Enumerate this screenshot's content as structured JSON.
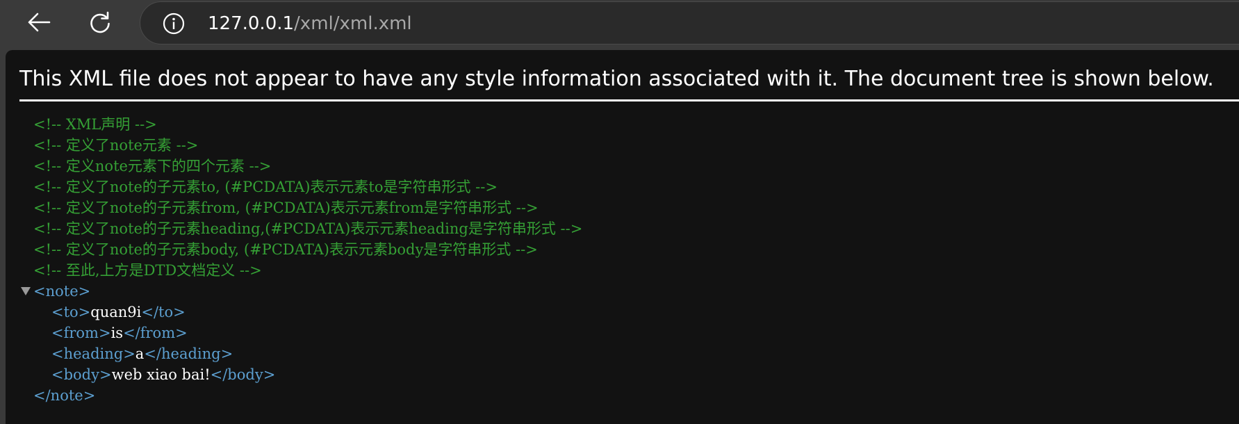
{
  "browser": {
    "url_host": "127.0.0.1",
    "url_path": "/xml/xml.xml",
    "back_icon": "arrow-left-icon",
    "reload_icon": "reload-icon",
    "info_icon": "info-icon"
  },
  "page": {
    "notice": "This XML file does not appear to have any style information associated with it. The document tree is shown below."
  },
  "comments": [
    "<!-- XML声明  -->",
    "<!-- 定义了note元素 -->",
    "<!-- 定义note元素下的四个元素 -->",
    "<!-- 定义了note的子元素to, (#PCDATA)表示元素to是字符串形式 -->",
    "<!-- 定义了note的子元素from, (#PCDATA)表示元素from是字符串形式 -->",
    "<!-- 定义了note的子元素heading,(#PCDATA)表示元素heading是字符串形式 -->",
    "<!-- 定义了note的子元素body, (#PCDATA)表示元素body是字符串形式 -->",
    "<!--  至此,上方是DTD文档定义 -->"
  ],
  "tree": {
    "toggle_glyph": "▼",
    "root_open": "<note>",
    "root_close": "</note>",
    "children": [
      {
        "open": "<to>",
        "text": "quan9i",
        "close": "</to>"
      },
      {
        "open": "<from>",
        "text": "is",
        "close": "</from>"
      },
      {
        "open": "<heading>",
        "text": "a",
        "close": "</heading>"
      },
      {
        "open": "<body>",
        "text": "web xiao bai!",
        "close": "</body>"
      }
    ]
  }
}
